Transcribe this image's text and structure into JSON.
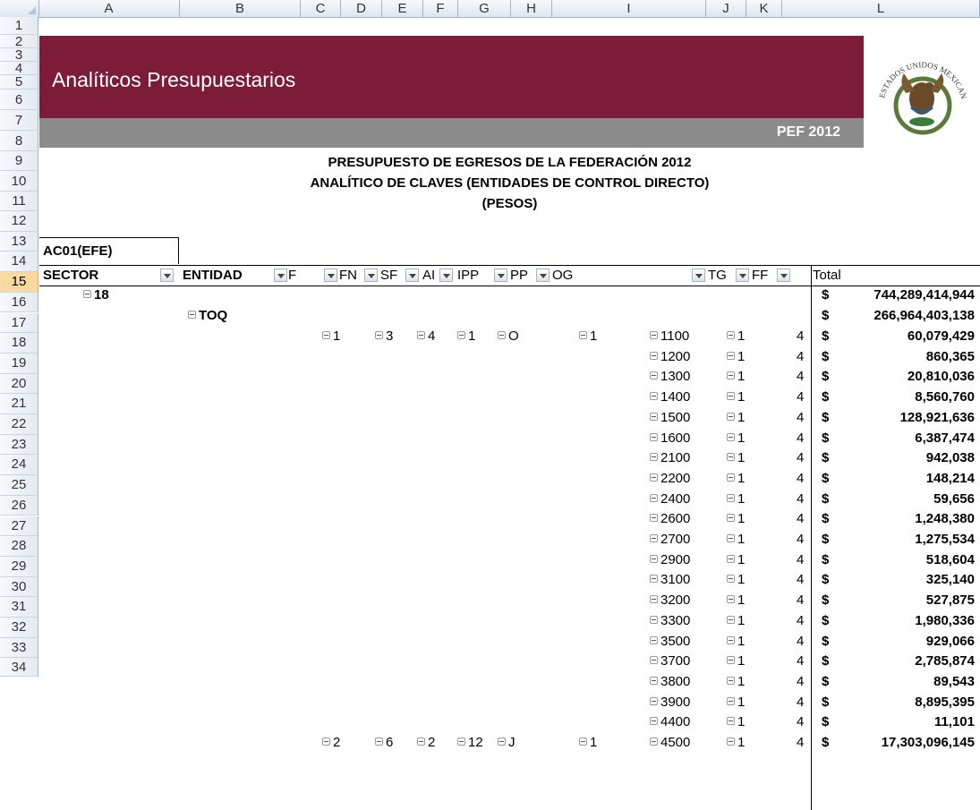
{
  "columns": [
    "A",
    "B",
    "C",
    "D",
    "E",
    "F",
    "G",
    "H",
    "I",
    "J",
    "K",
    "L"
  ],
  "row_numbers": [
    "1",
    "2",
    "3",
    "4",
    "5",
    "6",
    "7",
    "8",
    "9",
    "10",
    "11",
    "12",
    "13",
    "14",
    "15",
    "16",
    "17",
    "18",
    "19",
    "20",
    "21",
    "22",
    "23",
    "24",
    "25",
    "26",
    "27",
    "28",
    "29",
    "30",
    "31",
    "32",
    "33",
    "34"
  ],
  "selected_row": "15",
  "banner": {
    "title": "Analíticos Presupuestarios",
    "badge": "PEF 2012",
    "seal_text": "ESTADOS UNIDOS MEXICANOS",
    "colors": {
      "banner": "#7c1c3a",
      "band": "#8b8b8b"
    }
  },
  "titles": [
    "PRESUPUESTO DE EGRESOS DE LA FEDERACIÓN 2012",
    "ANALÍTICO DE CLAVES (ENTIDADES DE CONTROL DIRECTO)",
    "(PESOS)"
  ],
  "filter_label": "AC01(EFE)",
  "headers": {
    "sector": "SECTOR",
    "entidad": "ENTIDAD",
    "f": "F",
    "fn": "FN",
    "sf": "SF",
    "ai": "AI",
    "ipp": "IPP",
    "pp": "PP",
    "og": "OG",
    "tg": "TG",
    "ff": "FF",
    "total": "Total"
  },
  "summary": [
    {
      "label": "18",
      "dollar": "$",
      "amount": "744,289,414,944"
    },
    {
      "label": "TOQ",
      "dollar": "$",
      "amount": "266,964,403,138"
    }
  ],
  "rows": [
    {
      "f": "1",
      "fn": "3",
      "sf": "4",
      "ai": "1",
      "ipp": "O",
      "pp": "1",
      "og": "1100",
      "tg": "1",
      "ff": "4",
      "dollar": "$",
      "amount": "60,079,429"
    },
    {
      "og": "1200",
      "tg": "1",
      "ff": "4",
      "dollar": "$",
      "amount": "860,365"
    },
    {
      "og": "1300",
      "tg": "1",
      "ff": "4",
      "dollar": "$",
      "amount": "20,810,036"
    },
    {
      "og": "1400",
      "tg": "1",
      "ff": "4",
      "dollar": "$",
      "amount": "8,560,760"
    },
    {
      "og": "1500",
      "tg": "1",
      "ff": "4",
      "dollar": "$",
      "amount": "128,921,636"
    },
    {
      "og": "1600",
      "tg": "1",
      "ff": "4",
      "dollar": "$",
      "amount": "6,387,474"
    },
    {
      "og": "2100",
      "tg": "1",
      "ff": "4",
      "dollar": "$",
      "amount": "942,038"
    },
    {
      "og": "2200",
      "tg": "1",
      "ff": "4",
      "dollar": "$",
      "amount": "148,214"
    },
    {
      "og": "2400",
      "tg": "1",
      "ff": "4",
      "dollar": "$",
      "amount": "59,656"
    },
    {
      "og": "2600",
      "tg": "1",
      "ff": "4",
      "dollar": "$",
      "amount": "1,248,380"
    },
    {
      "og": "2700",
      "tg": "1",
      "ff": "4",
      "dollar": "$",
      "amount": "1,275,534"
    },
    {
      "og": "2900",
      "tg": "1",
      "ff": "4",
      "dollar": "$",
      "amount": "518,604"
    },
    {
      "og": "3100",
      "tg": "1",
      "ff": "4",
      "dollar": "$",
      "amount": "325,140"
    },
    {
      "og": "3200",
      "tg": "1",
      "ff": "4",
      "dollar": "$",
      "amount": "527,875"
    },
    {
      "og": "3300",
      "tg": "1",
      "ff": "4",
      "dollar": "$",
      "amount": "1,980,336"
    },
    {
      "og": "3500",
      "tg": "1",
      "ff": "4",
      "dollar": "$",
      "amount": "929,066"
    },
    {
      "og": "3700",
      "tg": "1",
      "ff": "4",
      "dollar": "$",
      "amount": "2,785,874"
    },
    {
      "og": "3800",
      "tg": "1",
      "ff": "4",
      "dollar": "$",
      "amount": "89,543"
    },
    {
      "og": "3900",
      "tg": "1",
      "ff": "4",
      "dollar": "$",
      "amount": "8,895,395"
    },
    {
      "og": "4400",
      "tg": "1",
      "ff": "4",
      "dollar": "$",
      "amount": "11,101"
    },
    {
      "f": "2",
      "fn": "6",
      "sf": "2",
      "ai": "12",
      "ipp": "J",
      "pp": "1",
      "og": "4500",
      "tg": "1",
      "ff": "4",
      "dollar": "$",
      "amount": "17,303,096,145"
    }
  ]
}
